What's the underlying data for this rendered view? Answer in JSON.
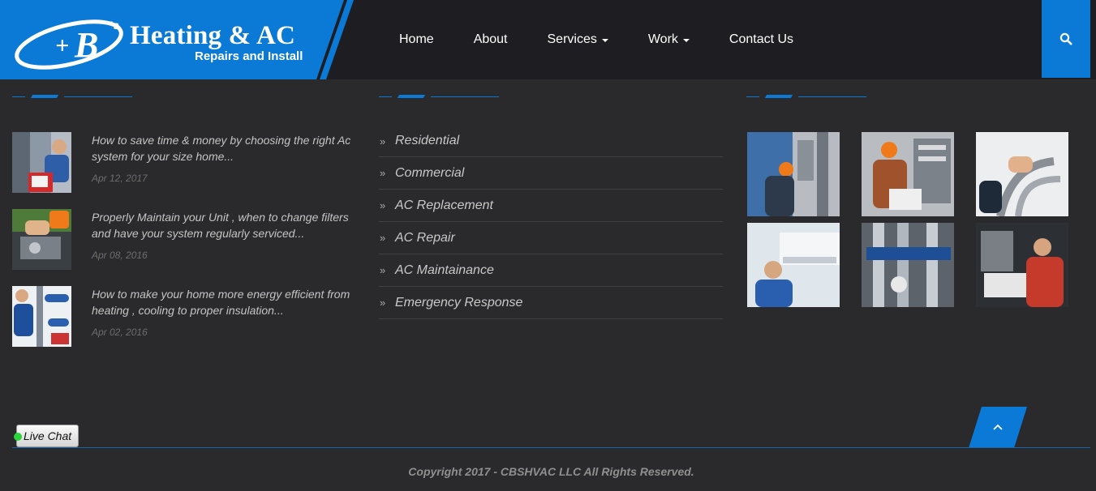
{
  "brand": {
    "mark": "CB's",
    "title": "Heating & AC",
    "subtitle": "Repairs and Install",
    "colors": {
      "accent": "#0a7ad6",
      "header_bg": "#1e1e22",
      "page_bg": "#2a2a2c"
    }
  },
  "nav": {
    "items": [
      {
        "label": "Home",
        "dropdown": false
      },
      {
        "label": "About",
        "dropdown": false
      },
      {
        "label": "Services",
        "dropdown": true
      },
      {
        "label": "Work",
        "dropdown": true
      },
      {
        "label": "Contact Us",
        "dropdown": false
      }
    ],
    "search_icon": "search-icon"
  },
  "recent_posts": [
    {
      "text": "How to save time & money by choosing the right Ac system for your size home...",
      "date": "Apr 12, 2017"
    },
    {
      "text": "Properly Maintain your Unit , when to change filters and have your system regularly serviced...",
      "date": "Apr 08, 2016"
    },
    {
      "text": "How to make your home more energy efficient from heating , cooling to proper insulation...",
      "date": "Apr 02, 2016"
    }
  ],
  "services": [
    "Residential",
    "Commercial",
    "AC Replacement",
    "AC Repair",
    "AC Maintainance",
    "Emergency Response"
  ],
  "footer": {
    "live_chat_label": "Live Chat",
    "back_to_top_icon": "chevron-up-icon",
    "copyright": "Copyright 2017 - CBSHVAC LLC All Rights Reserved."
  }
}
